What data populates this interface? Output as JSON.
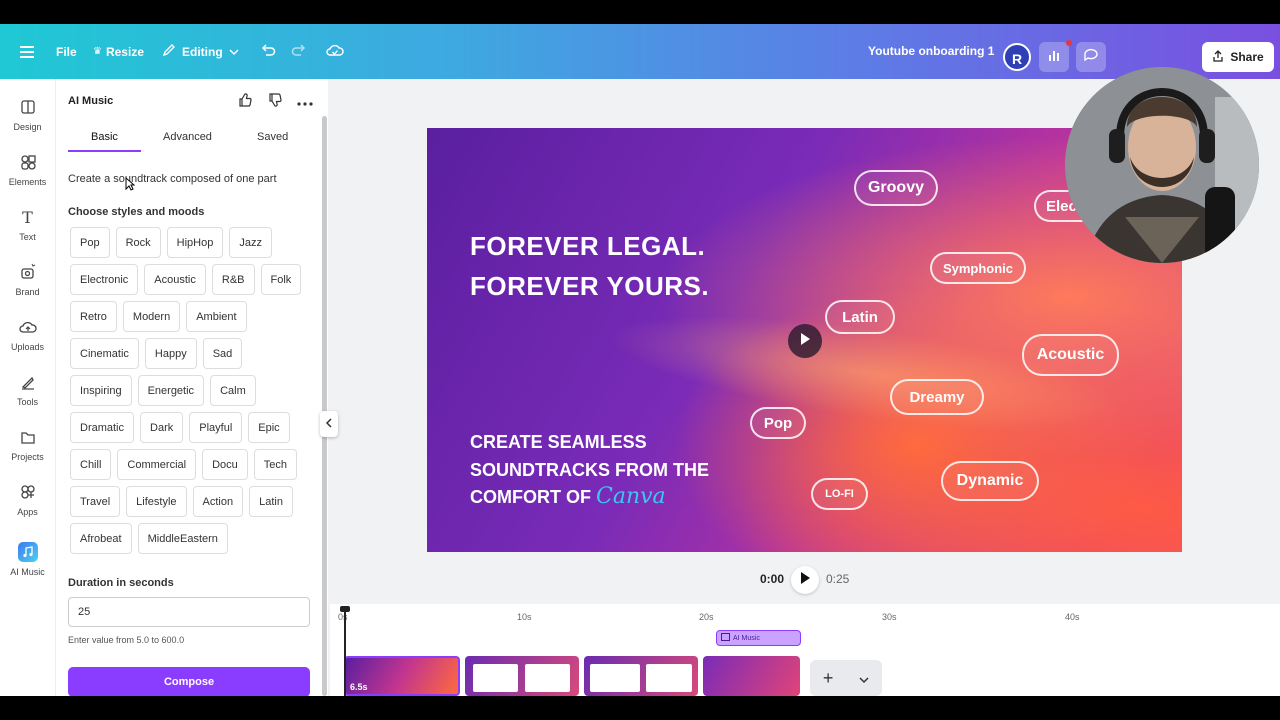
{
  "topbar": {
    "file_label": "File",
    "resize_label": "Resize",
    "editing_label": "Editing",
    "doc_title": "Youtube onboarding 1",
    "avatar_initial": "R",
    "share_label": "Share",
    "accent_color": "#8b3dff"
  },
  "rail": {
    "items": [
      {
        "label": "Design",
        "icon": "design-icon"
      },
      {
        "label": "Elements",
        "icon": "elements-icon"
      },
      {
        "label": "Text",
        "icon": "text-icon"
      },
      {
        "label": "Brand",
        "icon": "brand-icon"
      },
      {
        "label": "Uploads",
        "icon": "uploads-icon"
      },
      {
        "label": "Tools",
        "icon": "tools-icon"
      },
      {
        "label": "Projects",
        "icon": "projects-icon"
      },
      {
        "label": "Apps",
        "icon": "apps-icon"
      },
      {
        "label": "AI Music",
        "icon": "ai-music-icon"
      }
    ]
  },
  "panel": {
    "title": "AI Music",
    "tabs": [
      "Basic",
      "Advanced",
      "Saved"
    ],
    "active_tab": "Basic",
    "description": "Create a soundtrack composed of one part",
    "styles_label": "Choose styles and moods",
    "chips": [
      [
        "Pop",
        "Rock",
        "HipHop",
        "Jazz"
      ],
      [
        "Electronic",
        "Acoustic",
        "R&B",
        "Folk"
      ],
      [
        "Retro",
        "Modern",
        "Ambient"
      ],
      [
        "Cinematic",
        "Happy",
        "Sad"
      ],
      [
        "Inspiring",
        "Energetic",
        "Calm"
      ],
      [
        "Dramatic",
        "Dark",
        "Playful",
        "Epic"
      ],
      [
        "Chill",
        "Commercial",
        "Docu",
        "Tech"
      ],
      [
        "Travel",
        "Lifestyle",
        "Action",
        "Latin"
      ],
      [
        "Afrobeat",
        "MiddleEastern"
      ]
    ],
    "duration_label": "Duration in seconds",
    "duration_value": "25",
    "duration_hint": "Enter value from 5.0 to 600.0",
    "compose_label": "Compose"
  },
  "canvas": {
    "headline_1": "FOREVER LEGAL.",
    "headline_2": "FOREVER YOURS.",
    "sub_1": "CREATE SEAMLESS",
    "sub_2": "SOUNDTRACKS FROM THE",
    "sub_3": "COMFORT OF",
    "brand_word": "Canva",
    "bubbles": [
      "Groovy",
      "Electro",
      "Symphonic",
      "Latin",
      "Acoustic",
      "Dreamy",
      "Pop",
      "Dynamic",
      "LO-FI"
    ]
  },
  "playback": {
    "current": "0:00",
    "total": "0:25"
  },
  "timeline": {
    "ticks": [
      "0s",
      "10s",
      "20s",
      "30s",
      "40s"
    ],
    "audio_clip_label": "AI Music",
    "first_clip_time": "6.5s"
  }
}
